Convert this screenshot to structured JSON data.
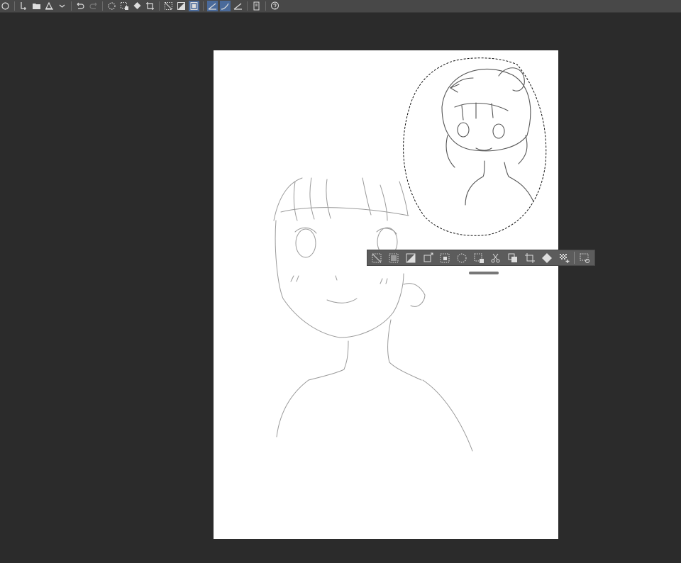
{
  "toolbar": {
    "icons": [
      "panel-icon",
      "new-file-icon",
      "open-file-icon",
      "save-icon",
      "dropdown-icon",
      "undo-icon",
      "redo-icon",
      "clear-icon",
      "fill-icon",
      "fill-bucket-icon",
      "crop-icon",
      "deselect-icon",
      "invert-selection-icon",
      "show-selection-icon",
      "snap-ruler-icon",
      "snap-special-ruler-icon",
      "ruler-icon",
      "device-icon",
      "help-icon"
    ],
    "active": [
      "show-selection-icon",
      "snap-ruler-icon",
      "snap-special-ruler-icon"
    ]
  },
  "selection_launcher": {
    "icons": [
      "deselect-icon",
      "select-all-icon",
      "invert-selection-icon",
      "expand-selection-icon",
      "shrink-selection-icon",
      "clear-outside-icon",
      "clear-inside-icon",
      "cut-icon",
      "copy-paste-icon",
      "crop-icon",
      "fill-icon",
      "new-layer-icon",
      "launcher-settings-icon"
    ]
  },
  "colors": {
    "workspace": "#2b2b2b",
    "toolbar": "#484848",
    "canvas": "#ffffff",
    "launcher": "#5c5c5c",
    "active": "#4a6a9a"
  }
}
